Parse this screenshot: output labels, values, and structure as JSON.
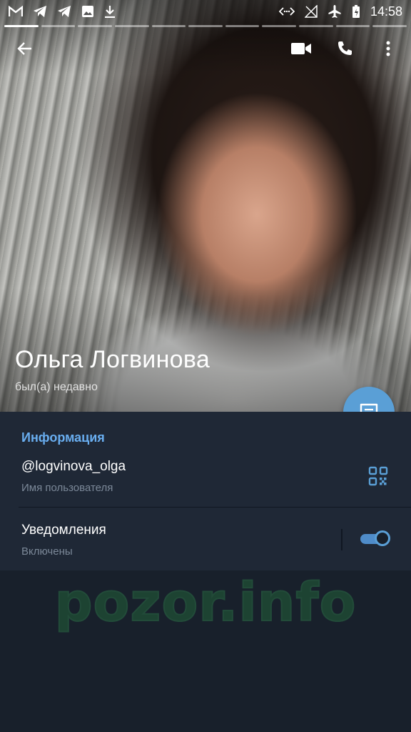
{
  "status_bar": {
    "time": "14:58",
    "left_icons": [
      "gmail-icon",
      "telegram-icon",
      "telegram-icon",
      "image-icon",
      "download-icon"
    ],
    "right_icons": [
      "data-saver-icon",
      "no-signal-icon",
      "airplane-icon",
      "battery-charging-icon"
    ]
  },
  "profile": {
    "name": "Ольга Логвинова",
    "last_seen": "был(а) недавно"
  },
  "toolbar": {
    "icons": [
      "back-arrow-icon",
      "video-call-icon",
      "phone-icon",
      "more-vert-icon"
    ]
  },
  "info": {
    "section_title": "Информация",
    "username": "@logvinova_olga",
    "username_label": "Имя пользователя",
    "notifications_title": "Уведомления",
    "notifications_status": "Включены",
    "notifications_enabled": true
  },
  "watermark": "pozor.info",
  "colors": {
    "accent": "#5a9fd6",
    "section_title": "#69aef0",
    "panel": "#1f2836",
    "background": "#18202b"
  }
}
